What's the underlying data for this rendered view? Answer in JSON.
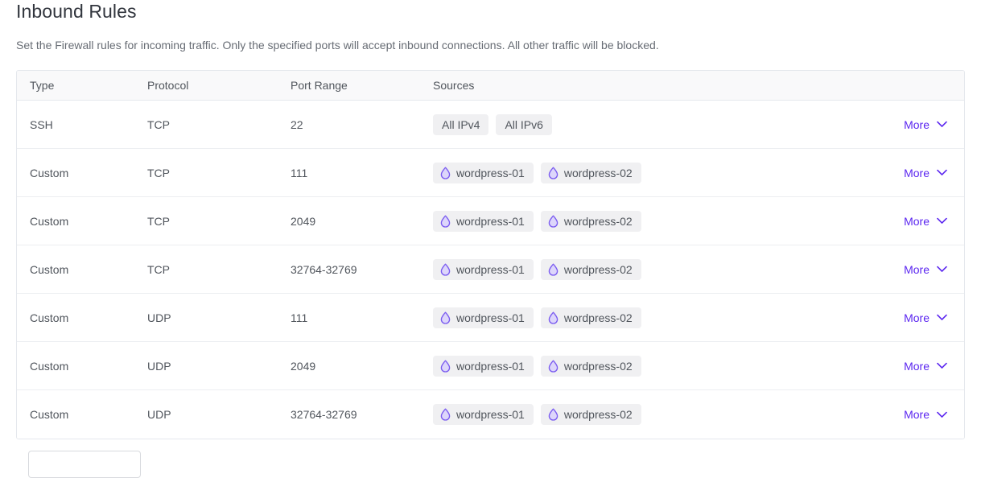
{
  "header": {
    "title": "Inbound Rules",
    "description": "Set the Firewall rules for incoming traffic. Only the specified ports will accept inbound connections. All other traffic will be blocked."
  },
  "table": {
    "columns": {
      "type": "Type",
      "protocol": "Protocol",
      "port_range": "Port Range",
      "sources": "Sources"
    },
    "action_label": "More",
    "rows": [
      {
        "type": "SSH",
        "protocol": "TCP",
        "port_range": "22",
        "sources": [
          {
            "label": "All IPv4",
            "icon": ""
          },
          {
            "label": "All IPv6",
            "icon": ""
          }
        ],
        "action": "More"
      },
      {
        "type": "Custom",
        "protocol": "TCP",
        "port_range": "111",
        "sources": [
          {
            "label": "wordpress-01",
            "icon": "droplet-icon"
          },
          {
            "label": "wordpress-02",
            "icon": "droplet-icon"
          }
        ],
        "action": "More"
      },
      {
        "type": "Custom",
        "protocol": "TCP",
        "port_range": "2049",
        "sources": [
          {
            "label": "wordpress-01",
            "icon": "droplet-icon"
          },
          {
            "label": "wordpress-02",
            "icon": "droplet-icon"
          }
        ],
        "action": "More"
      },
      {
        "type": "Custom",
        "protocol": "TCP",
        "port_range": "32764-32769",
        "sources": [
          {
            "label": "wordpress-01",
            "icon": "droplet-icon"
          },
          {
            "label": "wordpress-02",
            "icon": "droplet-icon"
          }
        ],
        "action": "More"
      },
      {
        "type": "Custom",
        "protocol": "UDP",
        "port_range": "111",
        "sources": [
          {
            "label": "wordpress-01",
            "icon": "droplet-icon"
          },
          {
            "label": "wordpress-02",
            "icon": "droplet-icon"
          }
        ],
        "action": "More"
      },
      {
        "type": "Custom",
        "protocol": "UDP",
        "port_range": "2049",
        "sources": [
          {
            "label": "wordpress-01",
            "icon": "droplet-icon"
          },
          {
            "label": "wordpress-02",
            "icon": "droplet-icon"
          }
        ],
        "action": "More"
      },
      {
        "type": "Custom",
        "protocol": "UDP",
        "port_range": "32764-32769",
        "sources": [
          {
            "label": "wordpress-01",
            "icon": "droplet-icon"
          },
          {
            "label": "wordpress-02",
            "icon": "droplet-icon"
          }
        ],
        "action": "More"
      }
    ]
  },
  "colors": {
    "accent": "#5b26f0",
    "droplet": "#7b5cf0",
    "text": "#50555c",
    "muted": "#676c74",
    "border": "#e5e8ed",
    "tag_bg": "#f0f0f2",
    "header_bg": "#f9f9fa"
  }
}
